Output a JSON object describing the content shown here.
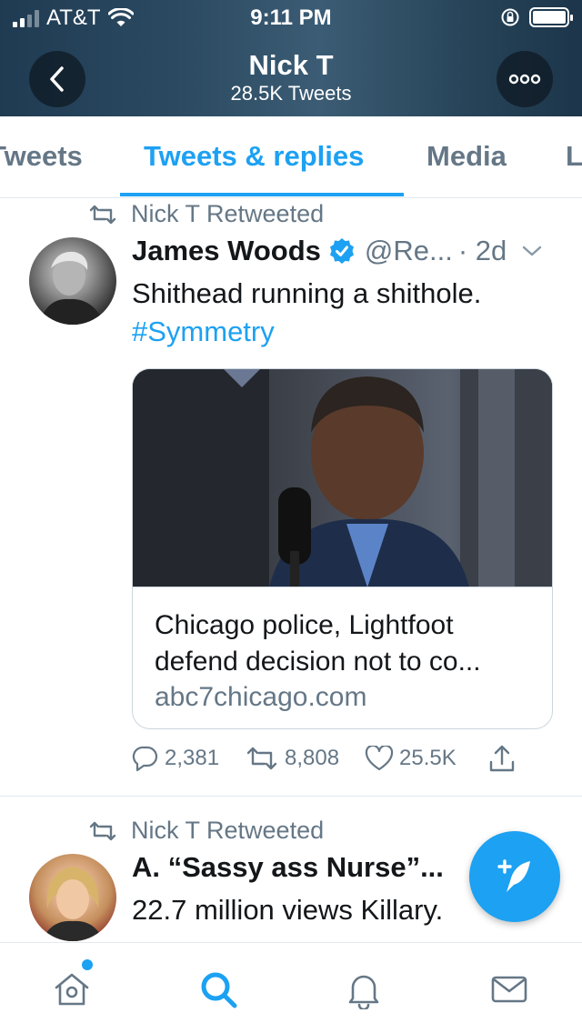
{
  "status_bar": {
    "carrier": "AT&T",
    "time": "9:11 PM"
  },
  "header": {
    "name": "Nick T",
    "tweet_count": "28.5K Tweets"
  },
  "tabs": [
    {
      "label": "Tweets",
      "active": false
    },
    {
      "label": "Tweets & replies",
      "active": true
    },
    {
      "label": "Media",
      "active": false
    },
    {
      "label": "Likes",
      "active": false
    }
  ],
  "tweets": [
    {
      "retweet_label": "Nick T Retweeted",
      "author": "James Woods",
      "verified": true,
      "handle": "@Re...",
      "time": "· 2d",
      "text": "Shithead running a shithole.",
      "hashtag": "#Symmetry",
      "card": {
        "title": "Chicago police, Lightfoot defend decision not to co...",
        "domain": "abc7chicago.com"
      },
      "replies": "2,381",
      "retweets": "8,808",
      "likes": "25.5K"
    },
    {
      "retweet_label": "Nick T Retweeted",
      "author": "A. “Sassy ass Nurse”...",
      "text": "22.7 million views Killary."
    }
  ],
  "icons": {
    "accent": "#1da1f2",
    "muted": "#657786"
  }
}
